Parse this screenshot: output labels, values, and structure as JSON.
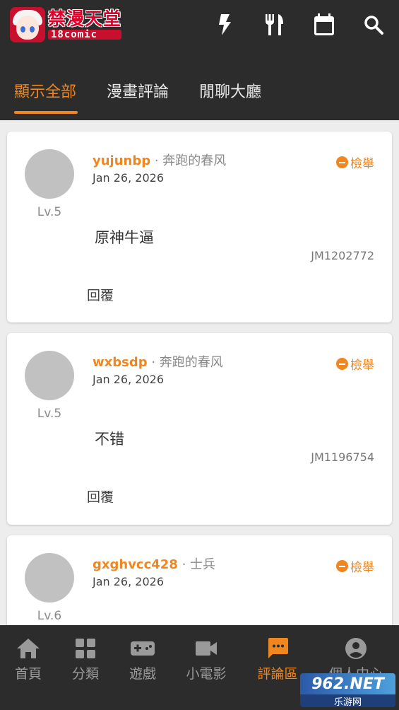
{
  "app": {
    "logo_cn": "禁漫天堂",
    "logo_en": "18comic"
  },
  "header_icons": [
    "lightning-icon",
    "restaurant-icon",
    "calendar-icon",
    "search-icon"
  ],
  "tabs": [
    {
      "label": "顯示全部",
      "active": true
    },
    {
      "label": "漫畫評論",
      "active": false
    },
    {
      "label": "閒聊大廳",
      "active": false
    }
  ],
  "comments": [
    {
      "username": "yujunbp",
      "title": "· 奔跑的春风",
      "date": "Jan 26, 2026",
      "level": "Lv.5",
      "report": "檢舉",
      "content": "原神牛逼",
      "code": "JM1202772",
      "reply": "回覆"
    },
    {
      "username": "wxbsdp",
      "title": "· 奔跑的春风",
      "date": "Jan 26, 2026",
      "level": "Lv.5",
      "report": "檢舉",
      "content": "不错",
      "code": "JM1196754",
      "reply": "回覆"
    },
    {
      "username": "gxghvcc428",
      "title": "· 士兵",
      "date": "Jan 26, 2026",
      "level": "Lv.6",
      "report": "檢舉"
    }
  ],
  "bottom_nav": [
    {
      "label": "首頁",
      "icon": "home-icon",
      "active": false
    },
    {
      "label": "分類",
      "icon": "grid-icon",
      "active": false
    },
    {
      "label": "遊戲",
      "icon": "gamepad-icon",
      "active": false
    },
    {
      "label": "小電影",
      "icon": "video-icon",
      "active": false
    },
    {
      "label": "評論區",
      "icon": "chat-icon",
      "active": true
    },
    {
      "label": "個人中心",
      "icon": "account-icon",
      "active": false
    }
  ],
  "watermark": {
    "top": "962.NET",
    "bottom": "乐游网"
  },
  "colors": {
    "accent": "#f0861f",
    "bar": "#2c2c2c",
    "background": "#ededed"
  }
}
